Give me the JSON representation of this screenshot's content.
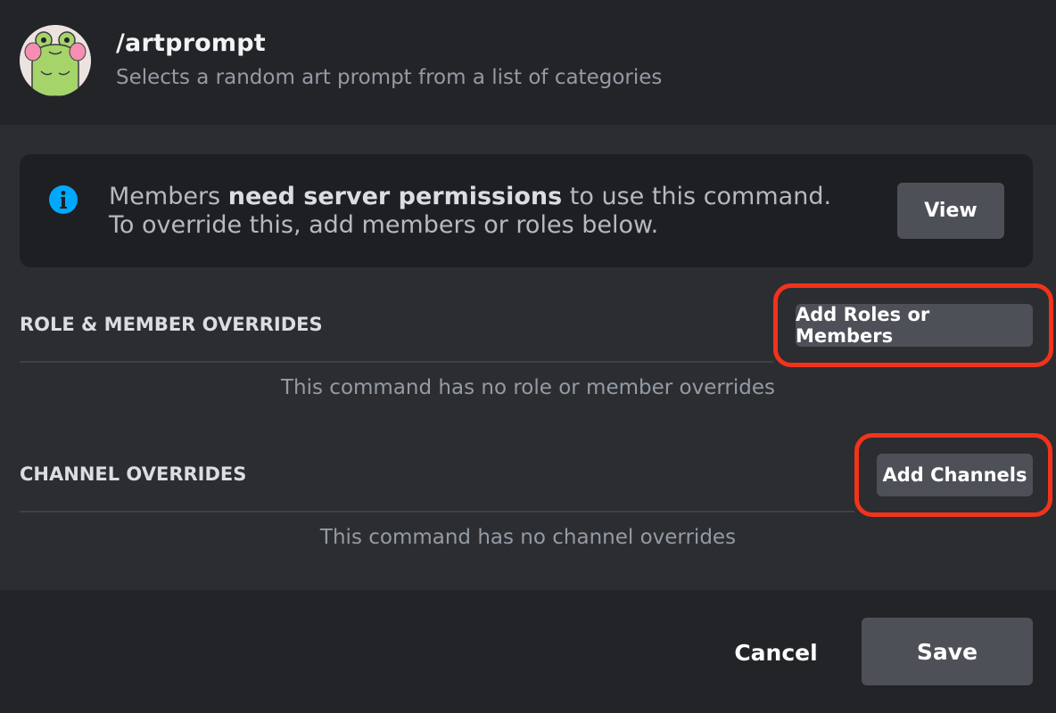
{
  "header": {
    "command_name": "/artprompt",
    "description": "Selects a random art prompt from a list of categories",
    "avatar_icon": "frog-avatar-icon"
  },
  "info": {
    "icon": "info-icon",
    "text_before": "Members ",
    "text_bold": "need server permissions",
    "text_after": " to use this command. To override this, add members or roles below.",
    "view_label": "View"
  },
  "roles_section": {
    "title": "ROLE & MEMBER OVERRIDES",
    "button_label": "Add Roles or Members",
    "empty_text": "This command has no role or member overrides"
  },
  "channels_section": {
    "title": "CHANNEL OVERRIDES",
    "button_label": "Add Channels",
    "empty_text": "This command has no channel overrides"
  },
  "footer": {
    "cancel_label": "Cancel",
    "save_label": "Save"
  },
  "colors": {
    "background": "#2b2d31",
    "header_bg": "#232428",
    "info_box_bg": "#1e1f22",
    "button_bg": "#4e5058",
    "info_blue": "#00a8fc",
    "highlight_red": "#f2331b"
  }
}
